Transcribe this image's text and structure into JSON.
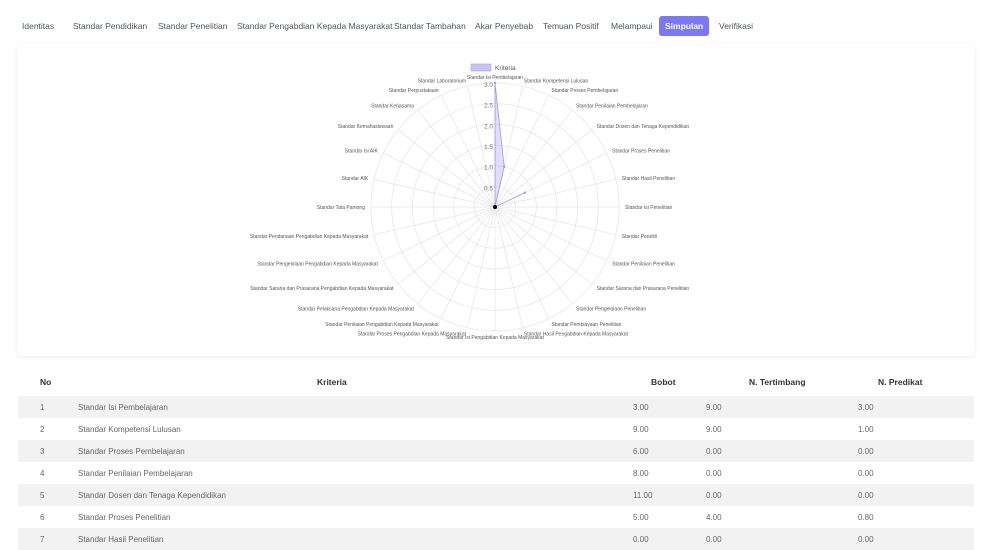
{
  "tabs": [
    "Identitas",
    "Standar Pendidikan",
    "Standar Penelitian",
    "Standar Pengabdian Kepada Masyarakat",
    "Standar Tambahan",
    "Akar Penyebab",
    "Temuan Positif",
    "Melampaui",
    "Simpulan",
    "Verifikasi"
  ],
  "active_tab": "Simpulan",
  "chart_data": {
    "type": "radar",
    "legend": "Kriteria",
    "legend_position": "top",
    "rlim": [
      0,
      3
    ],
    "ticks": [
      "0.5",
      "1.0",
      "1.5",
      "2.0",
      "2.5",
      "3.0"
    ],
    "series_color": "#a7a3f3",
    "categories": [
      "Standar Isi Pembelajaran",
      "Standar Kompetensi Lulusan",
      "Standar Proses Pembelajaran",
      "Standar Penilaian Pembelajaran",
      "Standar Dosen dan Tenaga Kependidikan",
      "Standar Proses Penelitian",
      "Standar Hasil Penelitian",
      "Standar Isi Penelitian",
      "Standar Peneliti",
      "Standar Penilaian Penelitian",
      "Standar Sarana dan Prasarana Penelitian",
      "Standar Pengelolaan Penelitian",
      "Standar Pembiayaan Penelitian",
      "Standar Hasil Pengabdian Kepada Masyarakat",
      "Standar Isi Pengabdian Kepada Masyarakat",
      "Standar Proses Pengabdian Kepada Masyarakat",
      "Standar Penilaian Pengabdian Kepada Masyarakat",
      "Standar Pelaksana Pengabdian Kepada Masyarakat",
      "Standar Sarana dan Prasarana Pengabdian Kepada Masyarakat",
      "Standar Pengelolaan Pengabdian Kepada Masyarakat",
      "Standar Pendanaan Pengabdian Kepada Masyarakat",
      "Standar Tata Pamong",
      "Standar AIK",
      "Standar Isi AIK",
      "Standar Kemahasiswaan",
      "Standar Kerjasama",
      "Standar Perpustakaan",
      "Standar Laboratorium"
    ],
    "values": [
      3.0,
      1.0,
      0,
      0,
      0,
      0.8,
      0,
      0,
      0,
      0,
      0,
      0,
      0,
      0,
      0,
      0,
      0,
      0,
      0,
      0,
      0,
      0,
      0,
      0,
      0,
      0,
      0,
      0
    ]
  },
  "table": {
    "headers": [
      "No",
      "Kriteria",
      "Bobot",
      "N. Tertimbang",
      "N. Predikat"
    ],
    "rows": [
      [
        "1",
        "Standar Isi Pembelajaran",
        "3.00",
        "9.00",
        "3.00"
      ],
      [
        "2",
        "Standar Kompetensi Lulusan",
        "9.00",
        "9.00",
        "1.00"
      ],
      [
        "3",
        "Standar Proses Pembelajaran",
        "6.00",
        "0.00",
        "0.00"
      ],
      [
        "4",
        "Standar Penilaian Pembelajaran",
        "8.00",
        "0.00",
        "0.00"
      ],
      [
        "5",
        "Standar Dosen dan Tenaga Kependidikan",
        "11.00",
        "0.00",
        "0.00"
      ],
      [
        "6",
        "Standar Proses Penelitian",
        "5.00",
        "4.00",
        "0.80"
      ],
      [
        "7",
        "Standar Hasil Penelitian",
        "0.00",
        "0.00",
        "0.00"
      ]
    ]
  }
}
